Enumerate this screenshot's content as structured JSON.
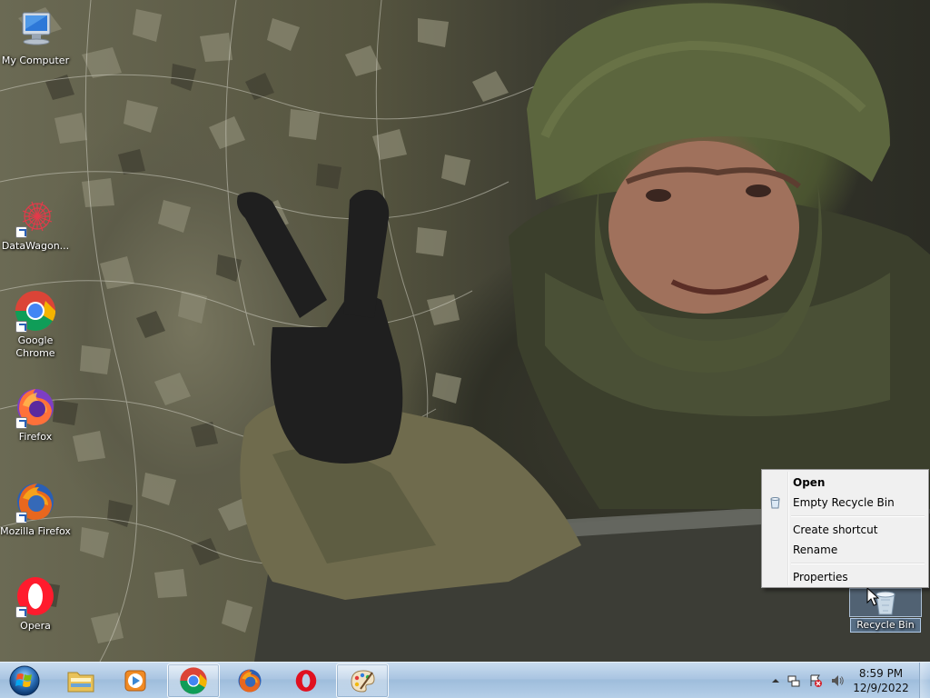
{
  "desktop": {
    "icons": [
      {
        "label": "My Computer"
      },
      {
        "label": "DataWagon..."
      },
      {
        "label": "Google Chrome"
      },
      {
        "label": "Firefox"
      },
      {
        "label": "Mozilla Firefox"
      },
      {
        "label": "Opera"
      },
      {
        "label": "Recycle Bin"
      }
    ]
  },
  "context_menu": {
    "items": [
      {
        "label": "Open"
      },
      {
        "label": "Empty Recycle Bin"
      },
      {
        "label": "Create shortcut"
      },
      {
        "label": "Rename"
      },
      {
        "label": "Properties"
      }
    ]
  },
  "taskbar": {
    "buttons": [
      "start-orb",
      "windows-explorer",
      "windows-media-player",
      "google-chrome",
      "firefox",
      "opera",
      "paint"
    ],
    "clock": {
      "time": "8:59 PM",
      "date": "12/9/2022"
    }
  },
  "colors": {
    "taskbar_top": "#c9dcef",
    "taskbar_bottom": "#b6cfe8",
    "menu_bg": "#f0f0f0"
  }
}
